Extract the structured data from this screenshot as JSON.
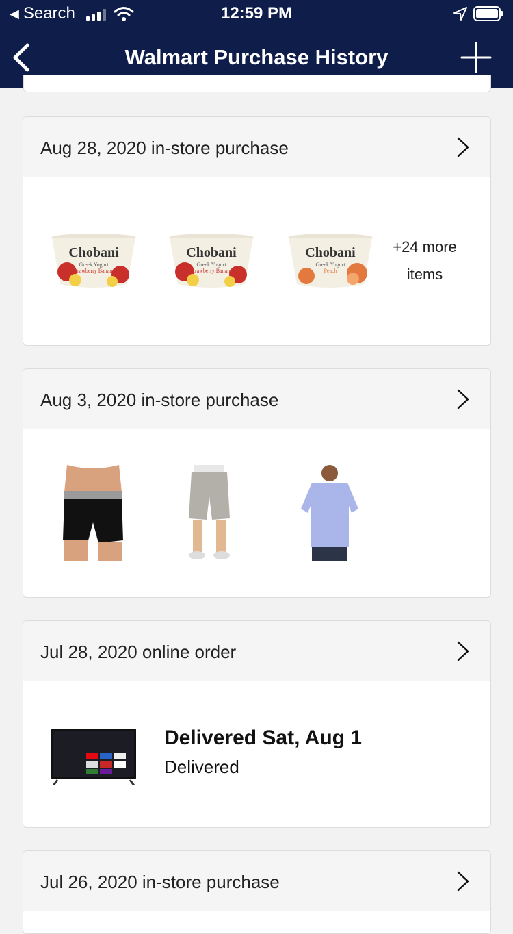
{
  "status_bar": {
    "back_app": "Search",
    "time": "12:59 PM"
  },
  "nav": {
    "title": "Walmart Purchase History",
    "back_icon": "chevron-left-icon",
    "add_icon": "plus-icon"
  },
  "colors": {
    "nav_background": "#0f1d4a",
    "card_header": "#f5f5f5"
  },
  "purchases": [
    {
      "title": "Aug 28, 2020 in-store purchase",
      "items": [
        "Chobani Greek Yogurt Strawberry Banana",
        "Chobani Greek Yogurt Strawberry Banana",
        "Chobani Greek Yogurt Peach"
      ],
      "more_label": "+24 more items"
    },
    {
      "title": "Aug 3, 2020 in-store purchase",
      "items": [
        "Boxer briefs",
        "Gray shorts",
        "Light blue polo shirt"
      ]
    },
    {
      "title": "Jul 28, 2020 online order",
      "items": [
        "Roku TV"
      ],
      "delivery_title": "Delivered  Sat, Aug 1",
      "delivery_status": "Delivered"
    },
    {
      "title": "Jul 26, 2020 in-store purchase"
    }
  ]
}
